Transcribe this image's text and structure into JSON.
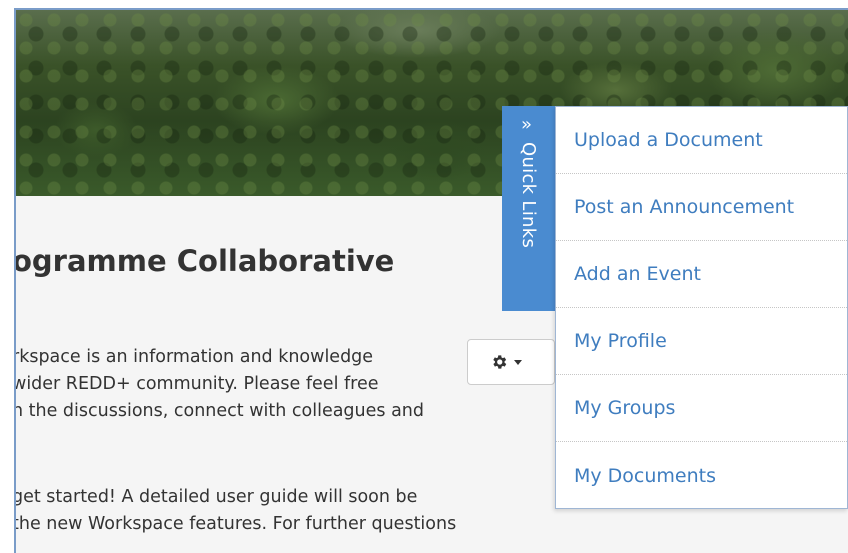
{
  "page": {
    "title": "ogramme Collaborative",
    "intro_lines": [
      "rkspace is an information and knowledge",
      "wider REDD+ community. Please feel free",
      "n the discussions, connect with colleagues and"
    ],
    "guide_lines": [
      "get started! A detailed user guide will soon be",
      "the new Workspace features. For further questions"
    ]
  },
  "settings_button": {
    "icon": "gear-icon",
    "caret": "chevron-down-icon"
  },
  "quick_links": {
    "tab_label": "Quick Links",
    "tab_icon": "double-chevron-right-icon",
    "accent_color": "#4a8bd0",
    "link_color": "#3f7dbf",
    "items": [
      {
        "label": "Upload a Document"
      },
      {
        "label": "Post an Announcement"
      },
      {
        "label": "Add an Event"
      },
      {
        "label": "My Profile"
      },
      {
        "label": "My Groups"
      },
      {
        "label": "My Documents"
      }
    ]
  }
}
